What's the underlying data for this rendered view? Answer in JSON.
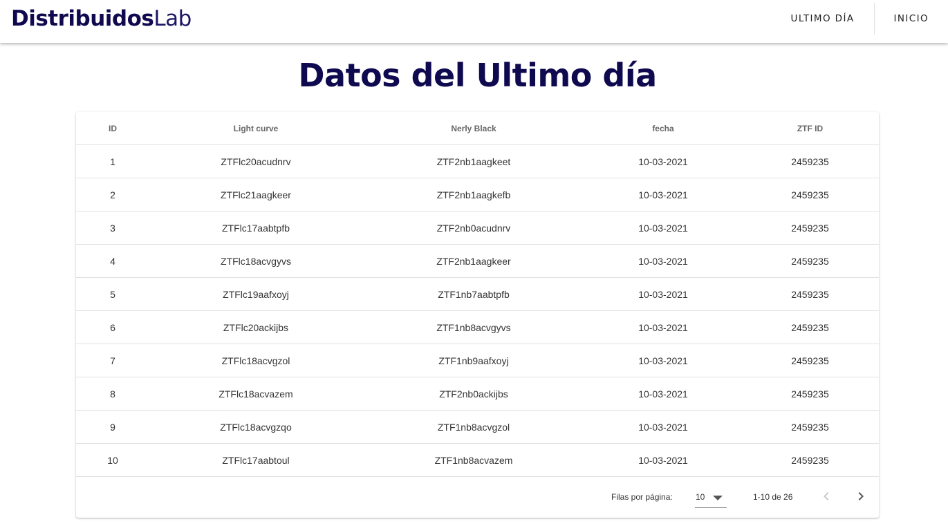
{
  "header": {
    "brand_bold": "Distribuidos",
    "brand_light": "Lab",
    "nav": [
      {
        "label": "ULTIMO DÍA"
      },
      {
        "label": "INICIO"
      }
    ]
  },
  "main": {
    "title": "Datos del Ultimo día"
  },
  "table": {
    "columns": [
      "ID",
      "Light curve",
      "Nerly Black",
      "fecha",
      "ZTF ID"
    ],
    "rows": [
      [
        "1",
        "ZTFlc20acudnrv",
        "ZTF2nb1aagkeet",
        "10-03-2021",
        "2459235"
      ],
      [
        "2",
        "ZTFlc21aagkeer",
        "ZTF2nb1aagkefb",
        "10-03-2021",
        "2459235"
      ],
      [
        "3",
        "ZTFlc17aabtpfb",
        "ZTF2nb0acudnrv",
        "10-03-2021",
        "2459235"
      ],
      [
        "4",
        "ZTFlc18acvgyvs",
        "ZTF2nb1aagkeer",
        "10-03-2021",
        "2459235"
      ],
      [
        "5",
        "ZTFlc19aafxoyj",
        "ZTF1nb7aabtpfb",
        "10-03-2021",
        "2459235"
      ],
      [
        "6",
        "ZTFlc20ackijbs",
        "ZTF1nb8acvgyvs",
        "10-03-2021",
        "2459235"
      ],
      [
        "7",
        "ZTFlc18acvgzol",
        "ZTF1nb9aafxoyj",
        "10-03-2021",
        "2459235"
      ],
      [
        "8",
        "ZTFlc18acvazem",
        "ZTF2nb0ackijbs",
        "10-03-2021",
        "2459235"
      ],
      [
        "9",
        "ZTFlc18acvgzqo",
        "ZTF1nb8acvgzol",
        "10-03-2021",
        "2459235"
      ],
      [
        "10",
        "ZTFlc17aabtoul",
        "ZTF1nb8acvazem",
        "10-03-2021",
        "2459235"
      ]
    ]
  },
  "pagination": {
    "rows_per_page_label": "Filas por página:",
    "rows_per_page_value": "10",
    "range_text": "1-10 de 26",
    "prev_icon": "chevron-left-icon",
    "next_icon": "chevron-right-icon",
    "prev_color": "#c8c8c8",
    "next_color": "#555555"
  },
  "colors": {
    "brand": "#0f0a4f",
    "title": "#0f0a4f",
    "divider": "#e0e0e0"
  }
}
